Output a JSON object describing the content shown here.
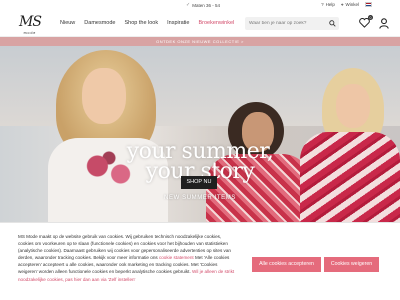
{
  "topbar": {
    "sizes_label": "Maten 36 - 54",
    "help_label": "Help",
    "cart_label": "Winkel"
  },
  "header": {
    "logo_text": "MS",
    "logo_sub": "mode",
    "nav": [
      "Nieuw",
      "Damesmode",
      "Shop the look",
      "Inspiratie",
      "Broekenwinkel"
    ],
    "search_placeholder": "Waar ben je naar op zoek?",
    "wishlist_count": "0"
  },
  "promo": {
    "text": "ONTDEK ONZE NIEUWE COLLECTIE >"
  },
  "hero": {
    "headline_line1": "your summer,",
    "headline_line2": "your story",
    "subline": "NEW SUMMER ITEMS",
    "cta": "SHOP NU"
  },
  "cookie": {
    "p1": "MS Mode maakt op de website gebruik van cookies. Wij gebruiken technisch noodzakelijke cookies, cookies om voorkeuren op te slaan (functionele cookies) en cookies voor het bijhouden van statistieken (analytische cookies). Daarnaast gebruiken wij cookies voor gepersonaliseerde advertenties op sites van derden, waaronder tracking cookies. Bekijk voor meer informatie ons",
    "link": "cookie statement",
    "p2": "Met 'Alle cookies accepteren' accepteert u alle cookies, waaronder ook marketing en tracking cookies. Met 'Cookies weigeren' worden alleen functionele cookies en beperkt analytische cookies gebruikt.",
    "link2": "Wil je alleen de strikt noodzakelijke cookies, pas hier dan aan via 'Zelf instellen'",
    "accept_all": "Alle cookies accepteren",
    "refuse": "Cookies weigeren"
  },
  "colors": {
    "accent": "#e56b7c",
    "promo_bg": "#d8a3a3",
    "sale_text": "#d24b6a"
  }
}
